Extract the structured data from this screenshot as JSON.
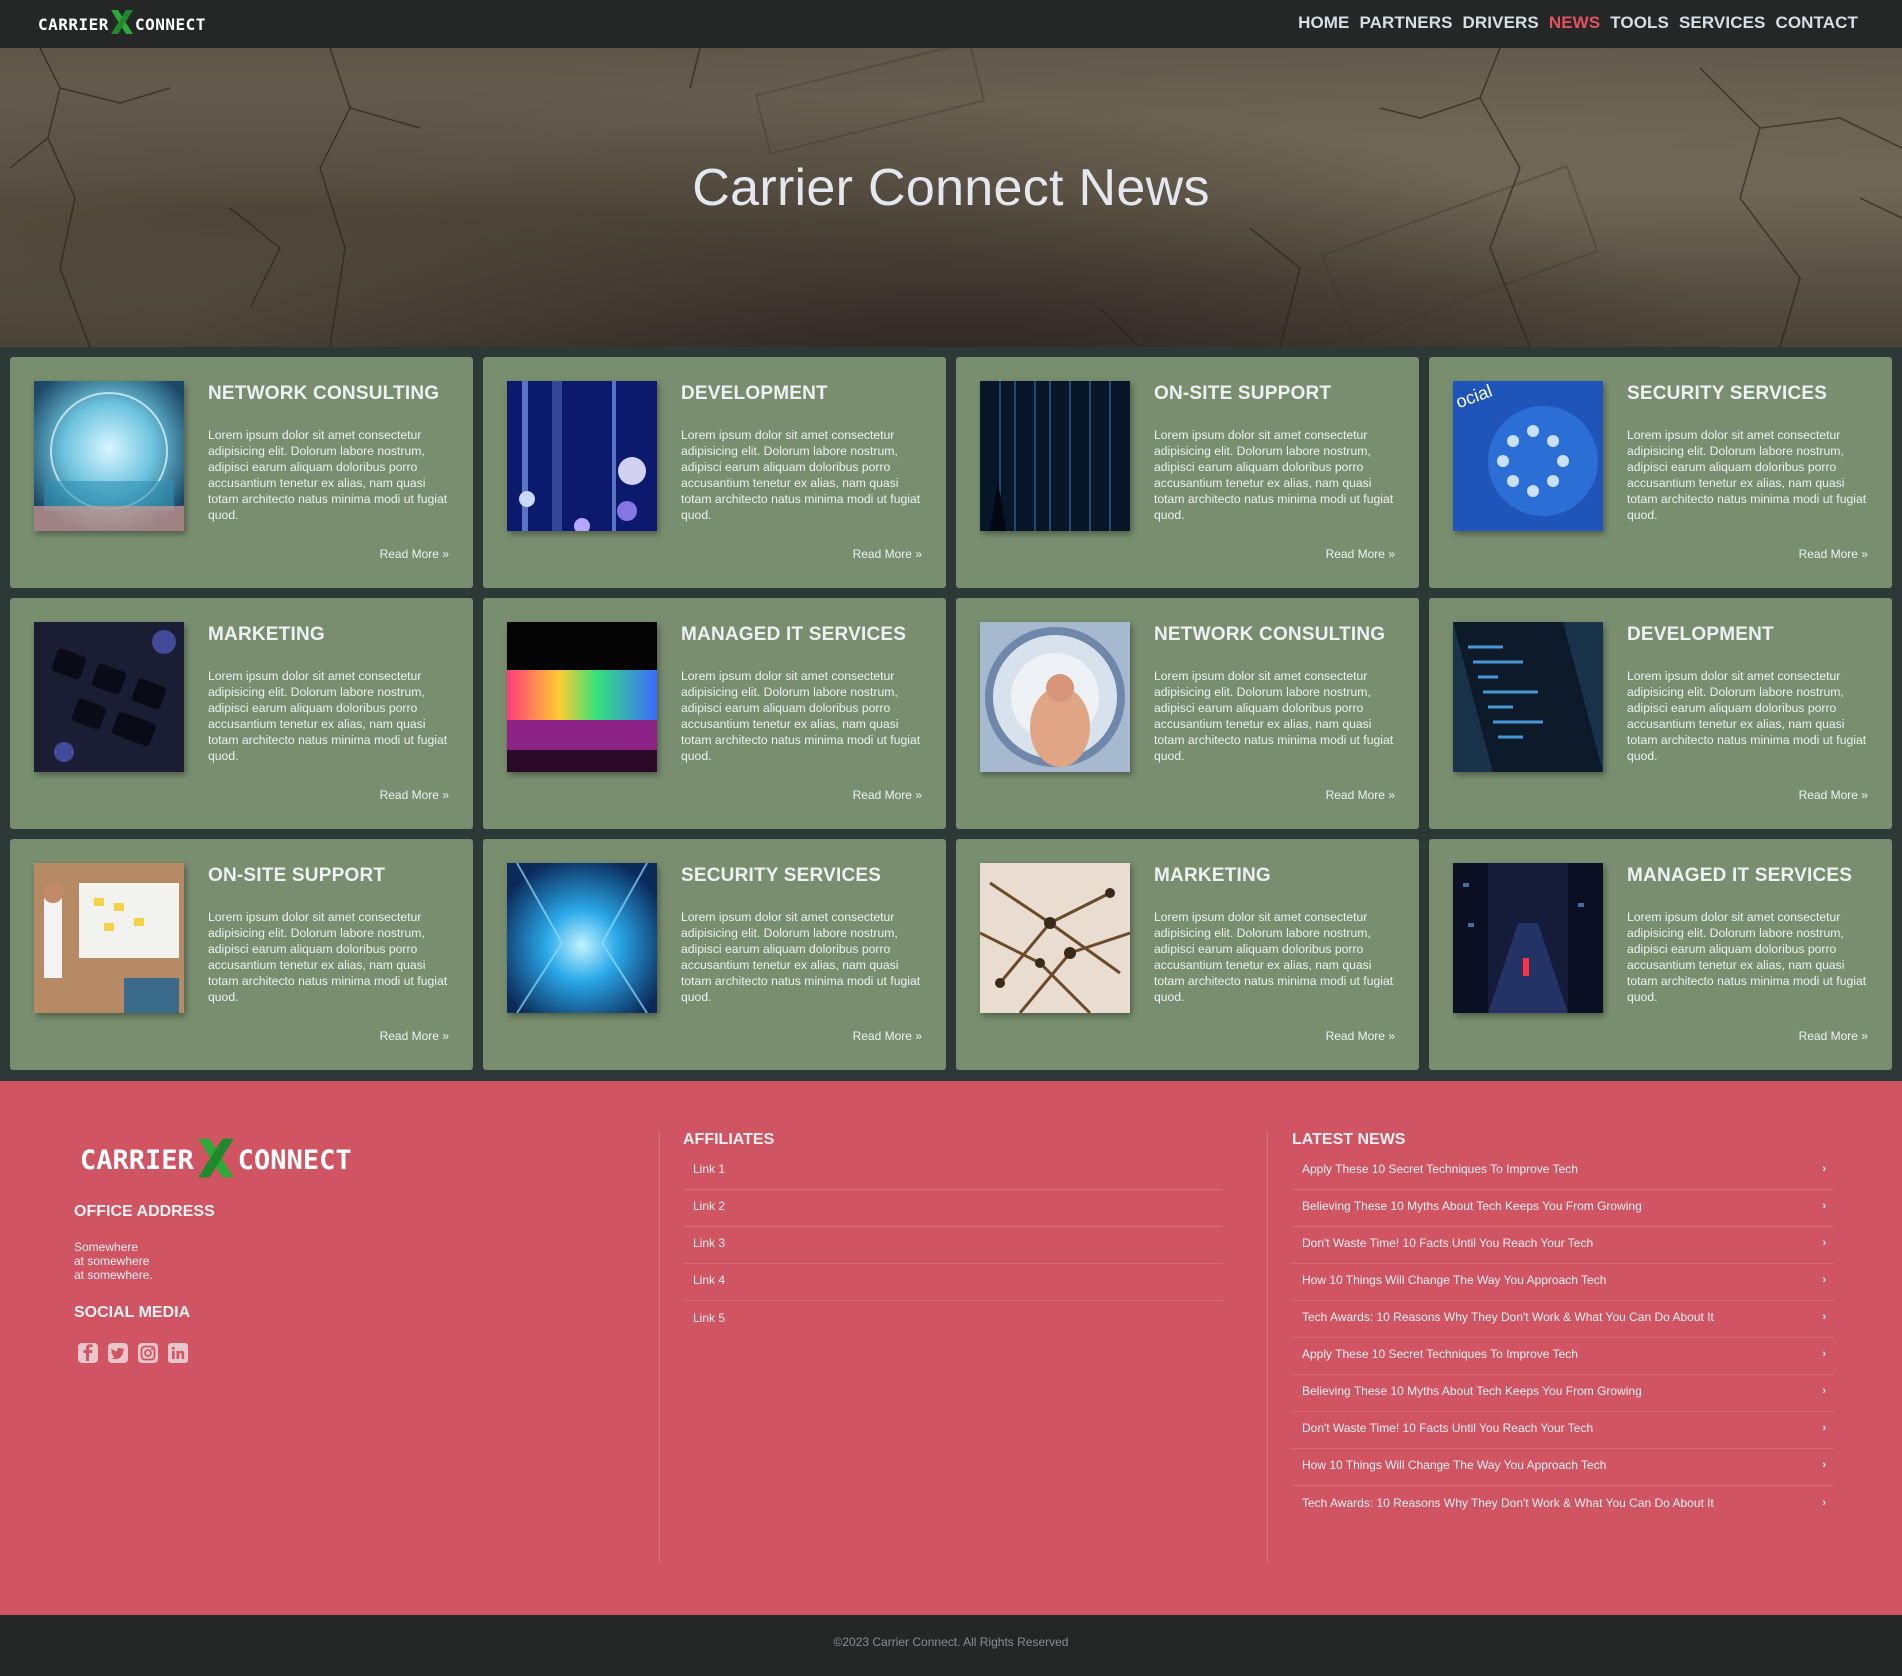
{
  "brand": {
    "word1": "CARRIER",
    "word2": "CONNECT",
    "accent": "#2fa83a"
  },
  "nav": {
    "items": [
      "HOME",
      "PARTNERS",
      "DRIVERS",
      "NEWS",
      "TOOLS",
      "SERVICES",
      "CONTACT"
    ],
    "active": "NEWS",
    "active_color": "#e15362"
  },
  "hero": {
    "title": "Carrier Connect News"
  },
  "cards": [
    {
      "title": "NETWORK CONSULTING",
      "image": "globe-network-image"
    },
    {
      "title": "DEVELOPMENT",
      "image": "light-beams-image"
    },
    {
      "title": "ON-SITE SUPPORT",
      "image": "digital-rain-image"
    },
    {
      "title": "SECURITY SERVICES",
      "image": "social-media-icons-image"
    },
    {
      "title": "MARKETING",
      "image": "keyboard-image"
    },
    {
      "title": "MANAGED IT SERVICES",
      "image": "rgb-laptop-image"
    },
    {
      "title": "NETWORK CONSULTING",
      "image": "slinky-hand-image"
    },
    {
      "title": "DEVELOPMENT",
      "image": "code-screen-image"
    },
    {
      "title": "ON-SITE SUPPORT",
      "image": "whiteboard-meeting-image"
    },
    {
      "title": "SECURITY SERVICES",
      "image": "server-room-image"
    },
    {
      "title": "MARKETING",
      "image": "pin-network-image"
    },
    {
      "title": "MANAGED IT SERVICES",
      "image": "night-city-street-image"
    }
  ],
  "card_body": "Lorem ipsum dolor sit amet consectetur adipisicing elit. Dolorum labore nostrum, adipisci earum aliquam doloribus porro accusantium tenetur ex alias, nam quasi totam architecto natus minima modi ut fugiat quod.",
  "read_more": "Read More",
  "footer": {
    "office_heading": "OFFICE ADDRESS",
    "address": [
      "Somewhere",
      "at somewhere",
      "at somewhere."
    ],
    "social_heading": "SOCIAL MEDIA",
    "social_icons": [
      "facebook-icon",
      "twitter-icon",
      "instagram-icon",
      "linkedin-icon"
    ],
    "affiliates_heading": "AFFILIATES",
    "affiliates": [
      "Link 1",
      "Link 2",
      "Link 3",
      "Link 4",
      "Link 5"
    ],
    "news_heading": "LATEST NEWS",
    "news": [
      "Apply These 10 Secret Techniques To Improve Tech",
      "Believing These 10 Myths About Tech Keeps You From Growing",
      "Don't Waste Time! 10 Facts Until You Reach Your Tech",
      "How 10 Things Will Change The Way You Approach Tech",
      "Tech Awards: 10 Reasons Why They Don't Work & What You Can Do About It",
      "Apply These 10 Secret Techniques To Improve Tech",
      "Believing These 10 Myths About Tech Keeps You From Growing",
      "Don't Waste Time! 10 Facts Until You Reach Your Tech",
      "How 10 Things Will Change The Way You Approach Tech",
      "Tech Awards: 10 Reasons Why They Don't Work & What You Can Do About It"
    ],
    "copyright": "©2023 Carrier Connect. All Rights Reserved",
    "bg_color": "#d05462"
  }
}
